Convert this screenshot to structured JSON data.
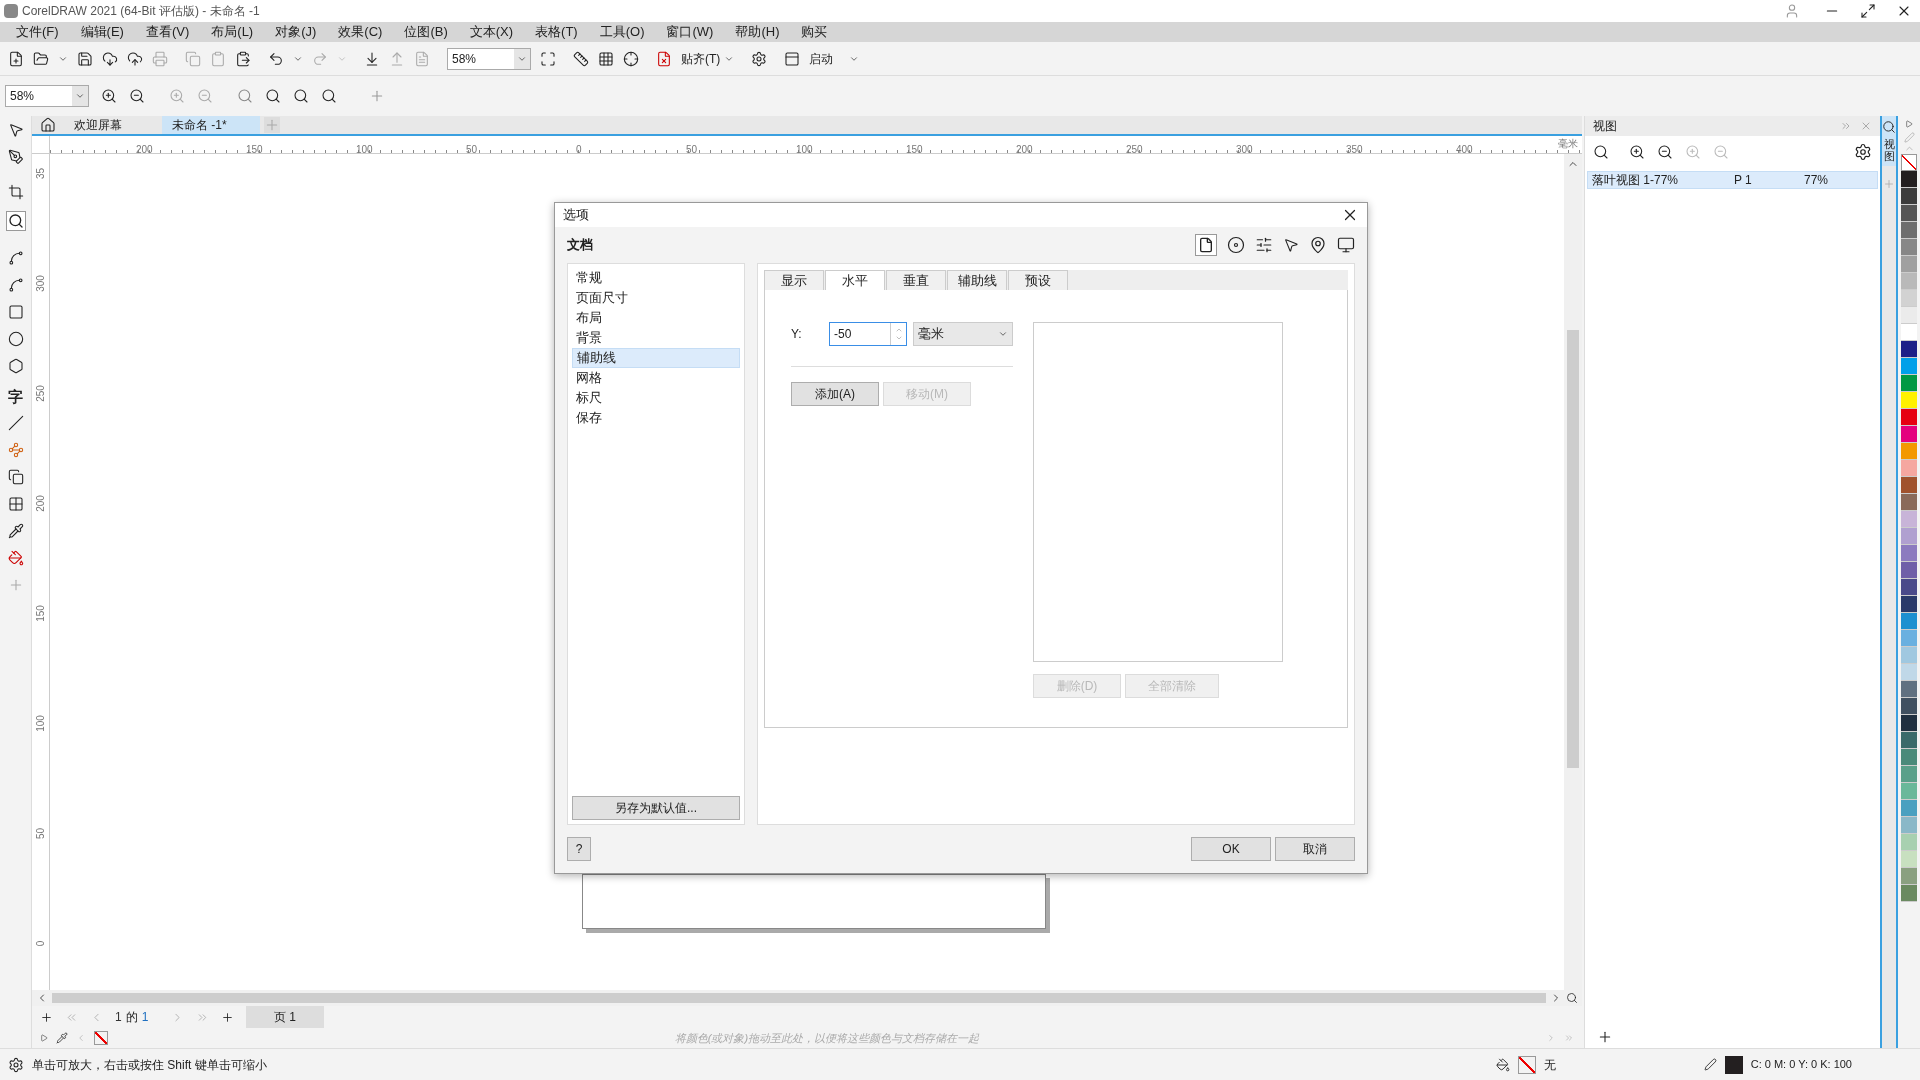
{
  "window": {
    "title": "CorelDRAW 2021 (64-Bit 评估版) - 未命名 -1"
  },
  "menu": [
    "文件(F)",
    "编辑(E)",
    "查看(V)",
    "布局(L)",
    "对象(J)",
    "效果(C)",
    "位图(B)",
    "文本(X)",
    "表格(T)",
    "工具(O)",
    "窗口(W)",
    "帮助(H)",
    "购买"
  ],
  "toolbar": {
    "zoom": "58%",
    "snap": "贴齐(T)",
    "launch": "启动"
  },
  "zoom_toolbar": {
    "zoom": "58%"
  },
  "toolbox": {
    "text_tool": "字"
  },
  "doc_tabs": [
    {
      "label": "欢迎屏幕",
      "selected": false
    },
    {
      "label": "未命名 -1*",
      "selected": true
    }
  ],
  "ruler": {
    "h_labels": [
      "200",
      "150",
      "100",
      "50",
      "0",
      "50",
      "100",
      "150",
      "200",
      "250",
      "300",
      "350",
      "400"
    ],
    "unit": "毫米",
    "v_labels": [
      "35",
      "300",
      "250",
      "200",
      "150",
      "100",
      "50",
      "0"
    ]
  },
  "dialog": {
    "title": "选项",
    "section": "文档",
    "categories": [
      {
        "label": "常规",
        "selected": false
      },
      {
        "label": "页面尺寸",
        "selected": false
      },
      {
        "label": "布局",
        "selected": false
      },
      {
        "label": "背景",
        "selected": false
      },
      {
        "label": "辅助线",
        "selected": true
      },
      {
        "label": "网格",
        "selected": false
      },
      {
        "label": "标尺",
        "selected": false
      },
      {
        "label": "保存",
        "selected": false
      }
    ],
    "tabs": [
      {
        "label": "显示",
        "selected": false
      },
      {
        "label": "水平",
        "selected": true
      },
      {
        "label": "垂直",
        "selected": false
      },
      {
        "label": "辅助线",
        "selected": false
      },
      {
        "label": "预设",
        "selected": false
      }
    ],
    "y_label": "Y:",
    "y_value": "-50",
    "unit": "毫米",
    "add": {
      "label": "添加(A)",
      "disabled": false
    },
    "move": {
      "label": "移动(M)",
      "disabled": true
    },
    "delete": {
      "label": "删除(D)",
      "disabled": true
    },
    "clear_all": {
      "label": "全部清除",
      "disabled": true
    },
    "save_default": "另存为默认值...",
    "help": "?",
    "ok": "OK",
    "cancel": "取消"
  },
  "page_nav": {
    "current": "1",
    "of": "的",
    "total": "1",
    "page_tab": "页 1"
  },
  "palette_hint": "将颜色(或对象)拖动至此处，以便将这些颜色与文档存储在一起",
  "docker": {
    "title": "视图",
    "tab": "视图",
    "rows": [
      {
        "name": "落叶视图 1-77%",
        "page": "P 1",
        "zoom": "77%",
        "selected": true
      }
    ]
  },
  "palette": [
    {
      "color": "#231f20"
    },
    {
      "color": "#3c3c3c"
    },
    {
      "color": "#555555"
    },
    {
      "color": "#6e6e6e"
    },
    {
      "color": "#878787"
    },
    {
      "color": "#a0a0a0"
    },
    {
      "color": "#b9b9b9"
    },
    {
      "color": "#d2d2d2"
    },
    {
      "color": "#ebebeb"
    },
    {
      "color": "#ffffff"
    },
    {
      "color": "#1d2088"
    },
    {
      "color": "#00a0e9"
    },
    {
      "color": "#009944"
    },
    {
      "color": "#fff100"
    },
    {
      "color": "#e60012"
    },
    {
      "color": "#e4007f"
    },
    {
      "color": "#f39800"
    },
    {
      "color": "#f5a7a0"
    },
    {
      "color": "#a0522d"
    },
    {
      "color": "#8a6a5a"
    },
    {
      "color": "#c8b4d8"
    },
    {
      "color": "#b0a0d0"
    },
    {
      "color": "#8c7bbf"
    },
    {
      "color": "#6f5fa8"
    },
    {
      "color": "#4a4a8a"
    },
    {
      "color": "#2a3a6a"
    },
    {
      "color": "#1e90d0"
    },
    {
      "color": "#6ab0e0"
    },
    {
      "color": "#a0c8e0"
    },
    {
      "color": "#c0d8e8"
    },
    {
      "color": "#607080"
    },
    {
      "color": "#405060"
    },
    {
      "color": "#203040"
    },
    {
      "color": "#3a6a6a"
    },
    {
      "color": "#4a8a7a"
    },
    {
      "color": "#5aa08a"
    },
    {
      "color": "#6ab89a"
    },
    {
      "color": "#4aa0c0"
    },
    {
      "color": "#8ab8c8"
    },
    {
      "color": "#a8d0b0"
    },
    {
      "color": "#c8e0c0"
    },
    {
      "color": "#8aa080"
    },
    {
      "color": "#6a8a60"
    }
  ],
  "status": {
    "hint": "单击可放大，右击或按住 Shift 键单击可缩小",
    "fill": "无",
    "outline": "C: 0 M: 0 Y: 0 K: 100"
  }
}
